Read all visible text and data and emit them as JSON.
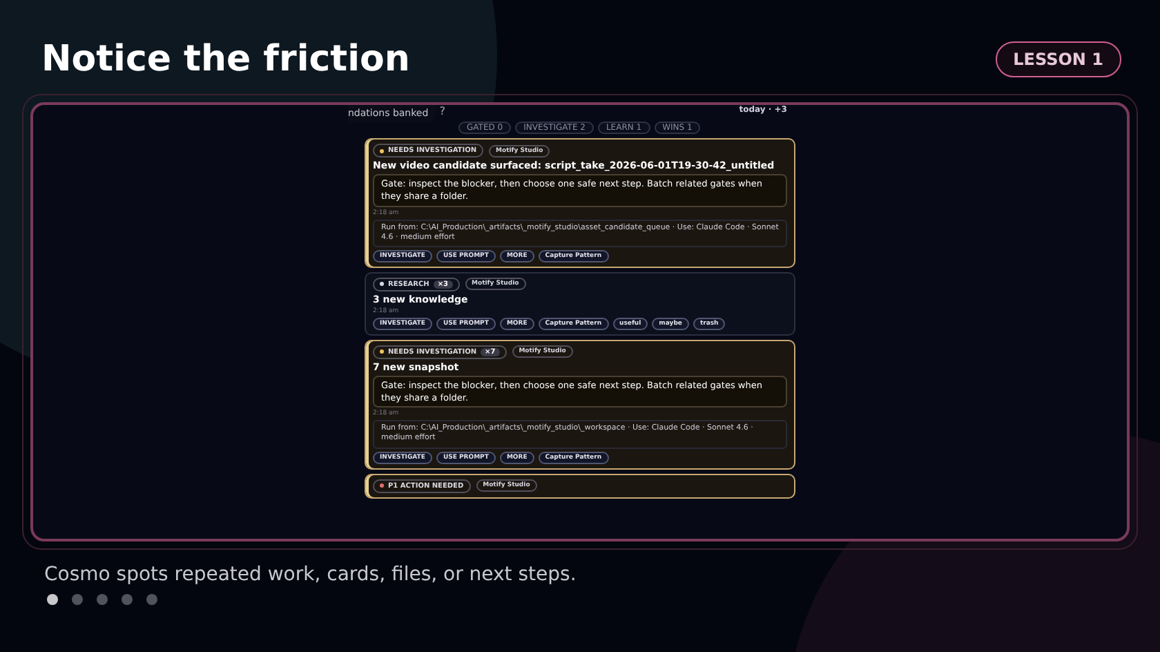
{
  "title": "Notice the friction",
  "lesson_badge": "LESSON 1",
  "feed": {
    "tooltip": "ndations banked",
    "tooltip_tail": "?",
    "summary": "today · +3",
    "filters": [
      {
        "label": "GATED 0",
        "selected": false
      },
      {
        "label": "INVESTIGATE 2",
        "selected": false
      },
      {
        "label": "LEARN 1",
        "selected": false
      },
      {
        "label": "WINS 1",
        "selected": false
      }
    ],
    "cards": [
      {
        "kind": "investigation",
        "status": "NEEDS INVESTIGATION",
        "project": "Motify Studio",
        "title": "New video candidate surfaced: script_take_2026-06-01T19-30-42_untitled",
        "gate": "Gate: inspect the blocker, then choose one safe next step. Batch related gates when they share a folder.",
        "time": "2:18 am",
        "run_from": "Run from: C:\\AI_Production\\_artifacts\\_motify_studio\\asset_candidate_queue · Use: Claude Code · Sonnet 4.6 · medium effort",
        "actions": [
          "INVESTIGATE",
          "USE PROMPT",
          "MORE",
          "Capture Pattern"
        ]
      },
      {
        "kind": "research",
        "status": "RESEARCH",
        "count": "×3",
        "project": "Motify Studio",
        "title": "3 new knowledge",
        "time": "2:18 am",
        "actions": [
          "INVESTIGATE",
          "USE PROMPT",
          "MORE",
          "Capture Pattern",
          "useful",
          "maybe",
          "trash"
        ]
      },
      {
        "kind": "investigation",
        "status": "NEEDS INVESTIGATION",
        "count": "×7",
        "project": "Motify Studio",
        "title": "7 new snapshot",
        "gate": "Gate: inspect the blocker, then choose one safe next step. Batch related gates when they share a folder.",
        "time": "2:18 am",
        "run_from": "Run from: C:\\AI_Production\\_artifacts\\_motify_studio\\_workspace · Use: Claude Code · Sonnet 4.6 · medium effort",
        "actions": [
          "INVESTIGATE",
          "USE PROMPT",
          "MORE",
          "Capture Pattern"
        ]
      },
      {
        "kind": "action",
        "status": "P1 ACTION NEEDED",
        "project": "Motify Studio"
      }
    ]
  },
  "caption": "Cosmo spots repeated work, cards, files, or next steps.",
  "pager": [
    {
      "selected": true
    },
    {
      "selected": false
    },
    {
      "selected": false
    },
    {
      "selected": false
    },
    {
      "selected": false
    }
  ]
}
